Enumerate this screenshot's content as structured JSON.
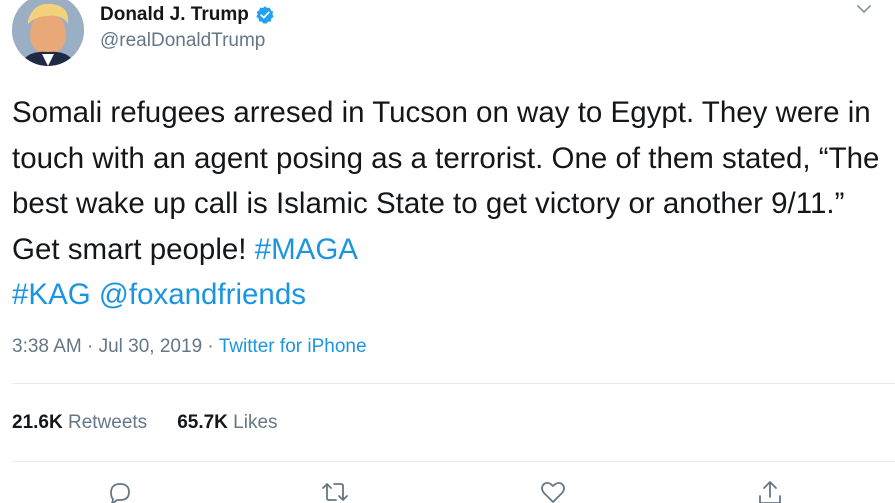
{
  "author": {
    "display_name": "Donald J. Trump",
    "handle": "@realDonaldTrump",
    "verified": true
  },
  "tweet": {
    "text_plain": "Somali refugees arresed in Tucson on way to Egypt. They were in touch with an agent posing as a terrorist. One of them stated, “The best wake up call is Islamic State to get victory or another 9/11.” Get smart people! ",
    "hashtag_maga": "#MAGA",
    "hashtag_kag": "#KAG",
    "mention": "@foxandfriends"
  },
  "meta": {
    "time": "3:38 AM",
    "sep1": " · ",
    "date": "Jul 30, 2019",
    "sep2": " · ",
    "source": "Twitter for iPhone"
  },
  "stats": {
    "retweets_count": "21.6K",
    "retweets_label": " Retweets",
    "likes_count": "65.7K",
    "likes_label": " Likes"
  },
  "icons": {
    "verified": "verified-badge-icon",
    "menu": "chevron-down-icon",
    "reply": "reply-icon",
    "retweet": "retweet-icon",
    "like": "heart-icon",
    "share": "share-icon"
  },
  "colors": {
    "link": "#1b95e0",
    "muted": "#657786",
    "text": "#14171a",
    "verified": "#1da1f2"
  }
}
